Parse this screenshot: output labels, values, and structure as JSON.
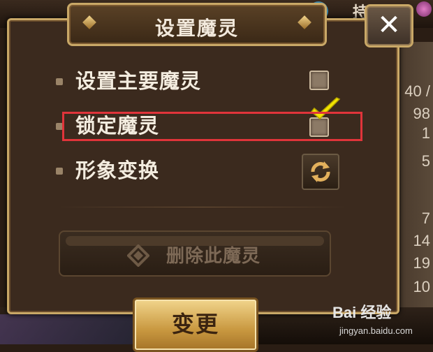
{
  "dialog": {
    "title": "设置魔灵",
    "close_label": "✕",
    "options": [
      {
        "label": "设置主要魔灵",
        "checked": false
      },
      {
        "label": "锁定魔灵",
        "checked": true
      },
      {
        "label": "形象变换",
        "control": "swap-icon"
      }
    ],
    "delete_label": "删除此魔灵",
    "confirm_label": "变更"
  },
  "background": {
    "top_right_glyph": "持",
    "right_numbers": [
      "40 /",
      "98",
      "1",
      "5",
      "7",
      "14",
      "19",
      "10"
    ]
  },
  "watermark": {
    "brand": "Bai 经验",
    "url": "jingyan.baidu.com"
  },
  "colors": {
    "frame_gold": "#c9a867",
    "panel_brown": "#3b2a1e",
    "highlight_red": "#e0343a",
    "check_yellow": "#f2e400"
  }
}
